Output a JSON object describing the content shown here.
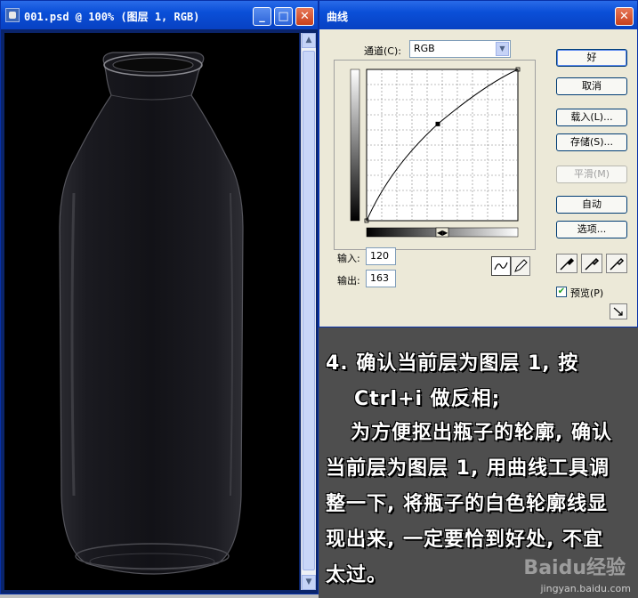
{
  "document_window": {
    "title": "001.psd @ 100% (图层 1, RGB)",
    "buttons": {
      "minimize": "_",
      "maximize": "□",
      "close": "✕"
    }
  },
  "curves_dialog": {
    "title": "曲线",
    "channel_label": "通道(C):",
    "channel_value": "RGB",
    "input_label": "输入:",
    "input_value": "120",
    "output_label": "输出:",
    "output_value": "163",
    "buttons": {
      "ok": "好",
      "cancel": "取消",
      "load": "载入(L)...",
      "save": "存储(S)...",
      "smooth": "平滑(M)",
      "auto": "自动",
      "options": "选项..."
    },
    "preview_label": "预览(P)",
    "preview_checked": true,
    "curve_point": {
      "input": 120,
      "output": 163
    }
  },
  "instruction": {
    "lines": [
      "4. 确认当前层为图层 1, 按",
      "Ctrl+i 做反相;",
      "为方便抠出瓶子的轮廓, 确认",
      "当前层为图层 1, 用曲线工具调",
      "整一下, 将瓶子的白色轮廓线显",
      "现出来, 一定要恰到好处, 不宜",
      "太过。"
    ]
  },
  "watermark": {
    "logo": "Baidu经验",
    "url": "jingyan.baidu.com"
  }
}
